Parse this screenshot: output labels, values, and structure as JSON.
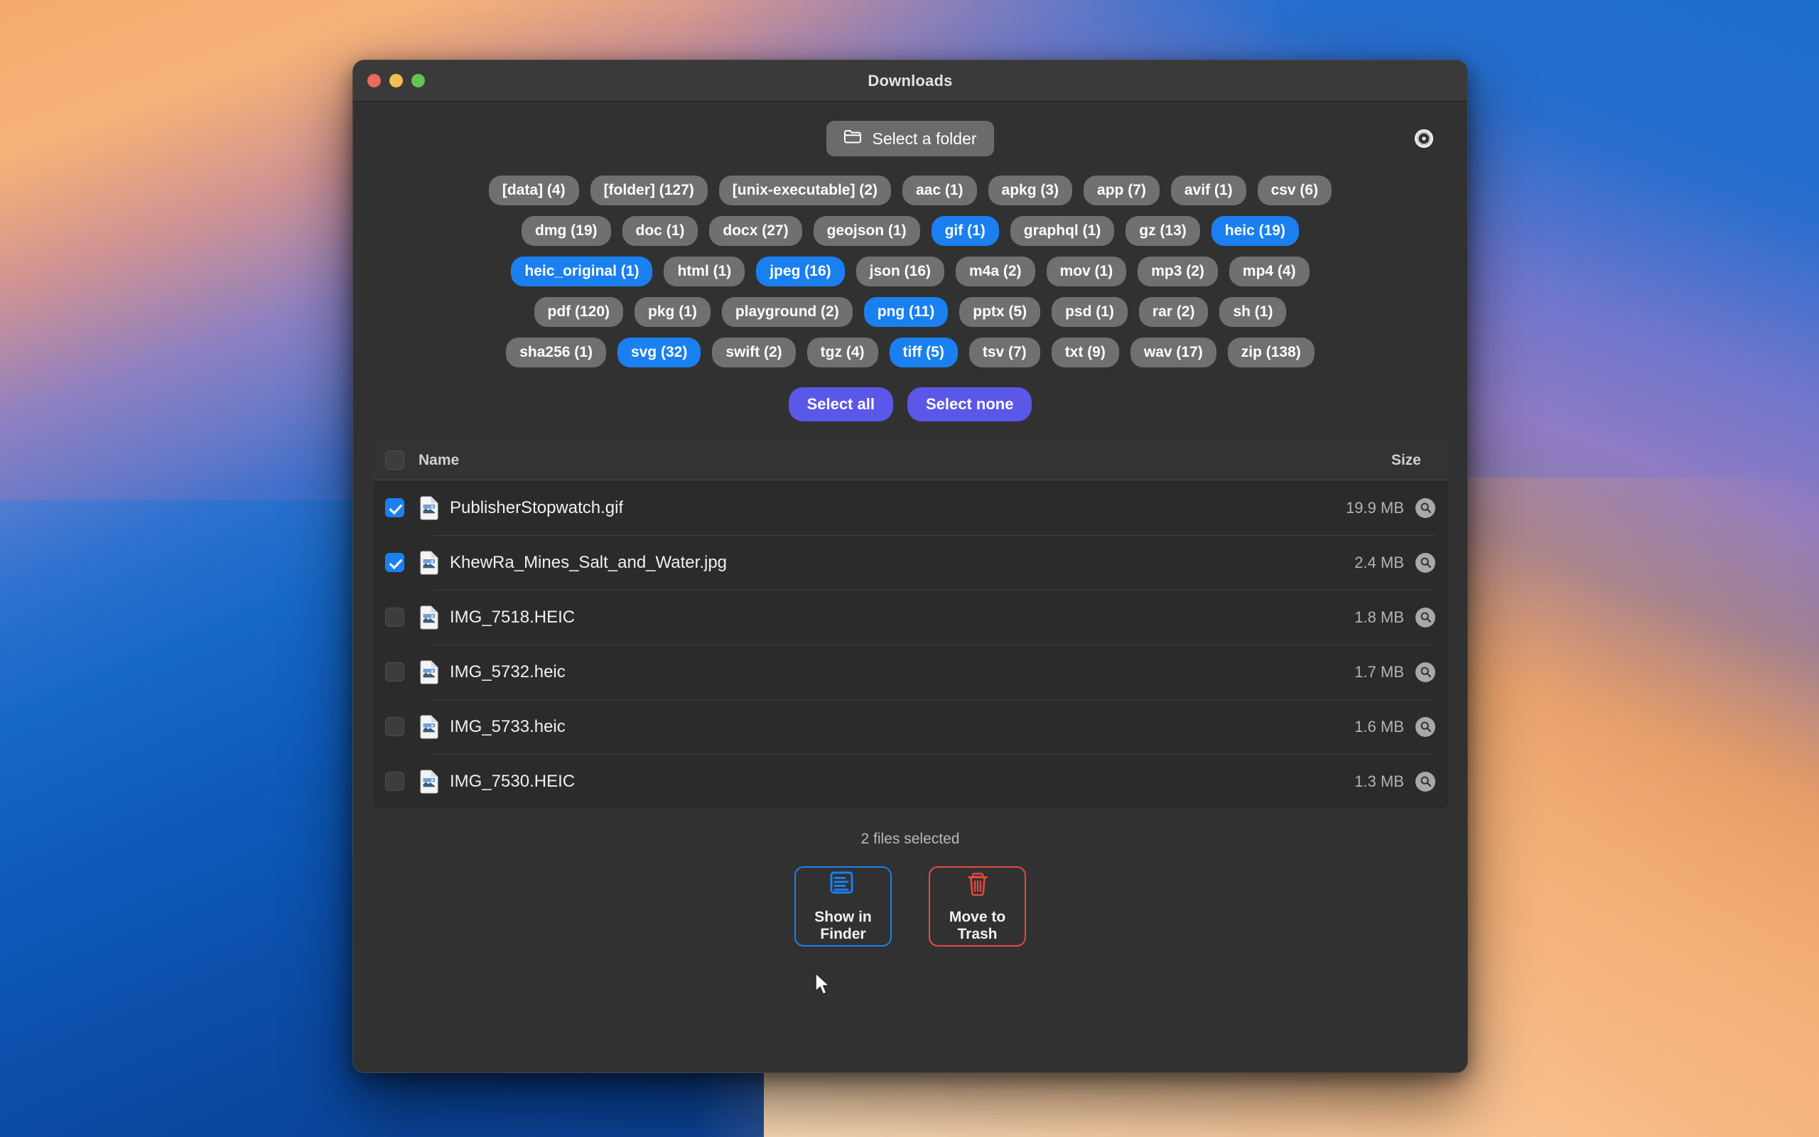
{
  "window": {
    "title": "Downloads",
    "traffic_lights": [
      "close",
      "minimize",
      "zoom"
    ]
  },
  "toolbar": {
    "select_folder_label": "Select a folder",
    "settings_icon": "gear-icon",
    "folder_icon": "folder-icon"
  },
  "filters": {
    "rows": [
      [
        {
          "label": "[data] (4)",
          "selected": false
        },
        {
          "label": "[folder] (127)",
          "selected": false
        },
        {
          "label": "[unix-executable] (2)",
          "selected": false
        },
        {
          "label": "aac (1)",
          "selected": false
        },
        {
          "label": "apkg (3)",
          "selected": false
        },
        {
          "label": "app (7)",
          "selected": false
        },
        {
          "label": "avif (1)",
          "selected": false
        },
        {
          "label": "csv (6)",
          "selected": false
        }
      ],
      [
        {
          "label": "dmg (19)",
          "selected": false
        },
        {
          "label": "doc (1)",
          "selected": false
        },
        {
          "label": "docx (27)",
          "selected": false
        },
        {
          "label": "geojson (1)",
          "selected": false
        },
        {
          "label": "gif (1)",
          "selected": true
        },
        {
          "label": "graphql (1)",
          "selected": false
        },
        {
          "label": "gz (13)",
          "selected": false
        },
        {
          "label": "heic (19)",
          "selected": true
        }
      ],
      [
        {
          "label": "heic_original (1)",
          "selected": true
        },
        {
          "label": "html (1)",
          "selected": false
        },
        {
          "label": "jpeg (16)",
          "selected": true
        },
        {
          "label": "json (16)",
          "selected": false
        },
        {
          "label": "m4a (2)",
          "selected": false
        },
        {
          "label": "mov (1)",
          "selected": false
        },
        {
          "label": "mp3 (2)",
          "selected": false
        },
        {
          "label": "mp4 (4)",
          "selected": false
        }
      ],
      [
        {
          "label": "pdf (120)",
          "selected": false
        },
        {
          "label": "pkg (1)",
          "selected": false
        },
        {
          "label": "playground (2)",
          "selected": false
        },
        {
          "label": "png (11)",
          "selected": true
        },
        {
          "label": "pptx (5)",
          "selected": false
        },
        {
          "label": "psd (1)",
          "selected": false
        },
        {
          "label": "rar (2)",
          "selected": false
        },
        {
          "label": "sh (1)",
          "selected": false
        }
      ],
      [
        {
          "label": "sha256 (1)",
          "selected": false
        },
        {
          "label": "svg (32)",
          "selected": true
        },
        {
          "label": "swift (2)",
          "selected": false
        },
        {
          "label": "tgz (4)",
          "selected": false
        },
        {
          "label": "tiff (5)",
          "selected": true
        },
        {
          "label": "tsv (7)",
          "selected": false
        },
        {
          "label": "txt (9)",
          "selected": false
        },
        {
          "label": "wav (17)",
          "selected": false
        },
        {
          "label": "zip (138)",
          "selected": false
        }
      ]
    ],
    "select_all_label": "Select all",
    "select_none_label": "Select none"
  },
  "table": {
    "columns": {
      "name": "Name",
      "size": "Size"
    },
    "header_checkbox_checked": false,
    "rows": [
      {
        "name": "PublisherStopwatch.gif",
        "size": "19.9 MB",
        "checked": true,
        "icon": "image-file-icon",
        "reveal_icon": "magnifier-icon"
      },
      {
        "name": "KhewRa_Mines_Salt_and_Water.jpg",
        "size": "2.4 MB",
        "checked": true,
        "icon": "image-file-icon",
        "reveal_icon": "magnifier-icon"
      },
      {
        "name": "IMG_7518.HEIC",
        "size": "1.8 MB",
        "checked": false,
        "icon": "image-file-icon",
        "reveal_icon": "magnifier-icon"
      },
      {
        "name": "IMG_5732.heic",
        "size": "1.7 MB",
        "checked": false,
        "icon": "image-file-icon",
        "reveal_icon": "magnifier-icon"
      },
      {
        "name": "IMG_5733.heic",
        "size": "1.6 MB",
        "checked": false,
        "icon": "image-file-icon",
        "reveal_icon": "magnifier-icon"
      },
      {
        "name": "IMG_7530.HEIC",
        "size": "1.3 MB",
        "checked": false,
        "icon": "image-file-icon",
        "reveal_icon": "magnifier-icon"
      }
    ]
  },
  "footer": {
    "status": "2 files selected",
    "show_in_finder_label": "Show in Finder",
    "move_to_trash_label": "Move to Trash",
    "finder_icon": "finder-document-icon",
    "trash_icon": "trash-icon"
  },
  "colors": {
    "accent_blue": "#1a80f0",
    "accent_purple": "#5b57e8",
    "danger_red": "#e04b3e",
    "chip_gray": "#707070",
    "window_bg": "#313131",
    "titlebar_bg": "#3a3a3a"
  }
}
